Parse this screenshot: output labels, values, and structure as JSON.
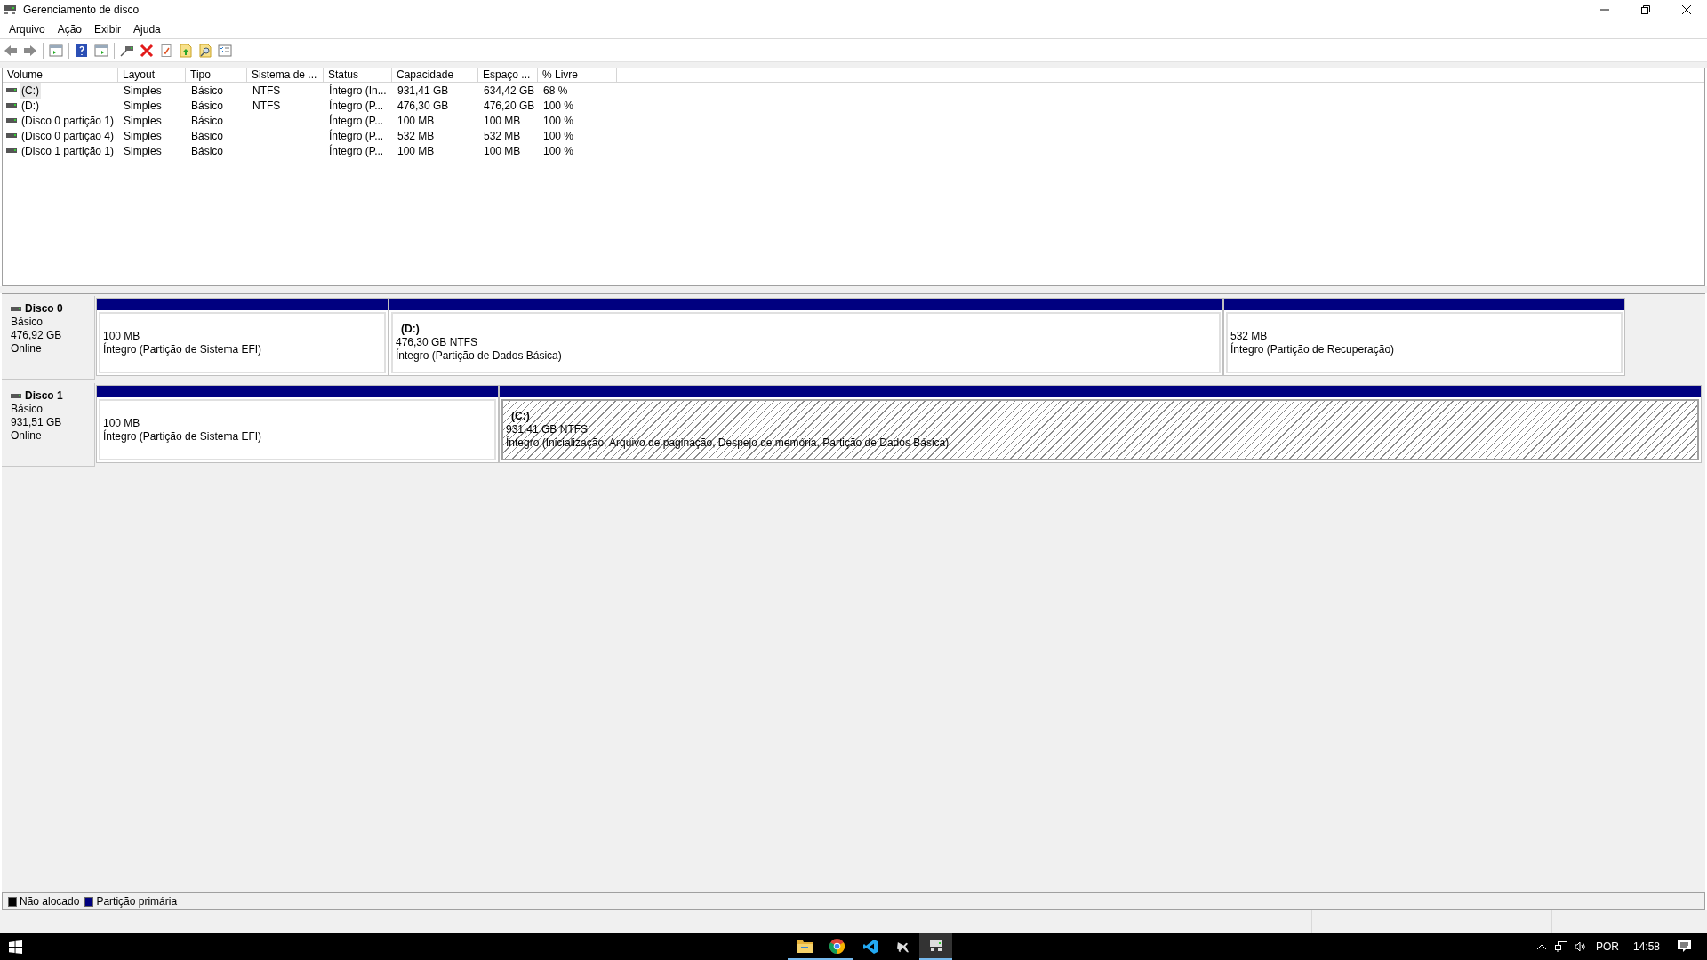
{
  "window": {
    "title": "Gerenciamento de disco"
  },
  "menu": [
    "Arquivo",
    "Ação",
    "Exibir",
    "Ajuda"
  ],
  "table": {
    "columns": [
      "Volume",
      "Layout",
      "Tipo",
      "Sistema de ...",
      "Status",
      "Capacidade",
      "Espaço ...",
      "% Livre"
    ],
    "rows": [
      {
        "selected": true,
        "cells": [
          "(C:)",
          "Simples",
          "Básico",
          "NTFS",
          "Íntegro (In...",
          "931,41 GB",
          "634,42 GB",
          "68 %"
        ]
      },
      {
        "selected": false,
        "cells": [
          "(D:)",
          "Simples",
          "Básico",
          "NTFS",
          "Íntegro (P...",
          "476,30 GB",
          "476,20 GB",
          "100 %"
        ]
      },
      {
        "selected": false,
        "cells": [
          "(Disco 0 partição 1)",
          "Simples",
          "Básico",
          "",
          "Íntegro (P...",
          "100 MB",
          "100 MB",
          "100 %"
        ]
      },
      {
        "selected": false,
        "cells": [
          "(Disco 0 partição 4)",
          "Simples",
          "Básico",
          "",
          "Íntegro (P...",
          "532 MB",
          "532 MB",
          "100 %"
        ]
      },
      {
        "selected": false,
        "cells": [
          "(Disco 1 partição 1)",
          "Simples",
          "Básico",
          "",
          "Íntegro (P...",
          "100 MB",
          "100 MB",
          "100 %"
        ]
      }
    ]
  },
  "disks": [
    {
      "name": "Disco 0",
      "type": "Básico",
      "size": "476,92 GB",
      "status": "Online",
      "partitions": [
        {
          "selected": false,
          "size": "100 MB",
          "status": "Íntegro (Partição de Sistema EFI)"
        },
        {
          "selected": false,
          "label": "(D:)",
          "size": "476,30 GB NTFS",
          "status": "Íntegro (Partição de Dados Básica)"
        },
        {
          "selected": false,
          "size": "532 MB",
          "status": "Íntegro (Partição de Recuperação)"
        }
      ]
    },
    {
      "name": "Disco 1",
      "type": "Básico",
      "size": "931,51 GB",
      "status": "Online",
      "partitions": [
        {
          "selected": false,
          "size": "100 MB",
          "status": "Íntegro (Partição de Sistema EFI)"
        },
        {
          "selected": true,
          "label": "(C:)",
          "size": "931,41 GB NTFS",
          "status": "Íntegro (Inicialização, Arquivo de paginação, Despejo de memória, Partição de Dados Básica)"
        }
      ]
    }
  ],
  "legend": [
    {
      "label": "Não alocado",
      "color": "#000000"
    },
    {
      "label": "Partição primária",
      "color": "#000080"
    }
  ],
  "taskbar": {
    "language": "POR",
    "time": "14:58"
  }
}
